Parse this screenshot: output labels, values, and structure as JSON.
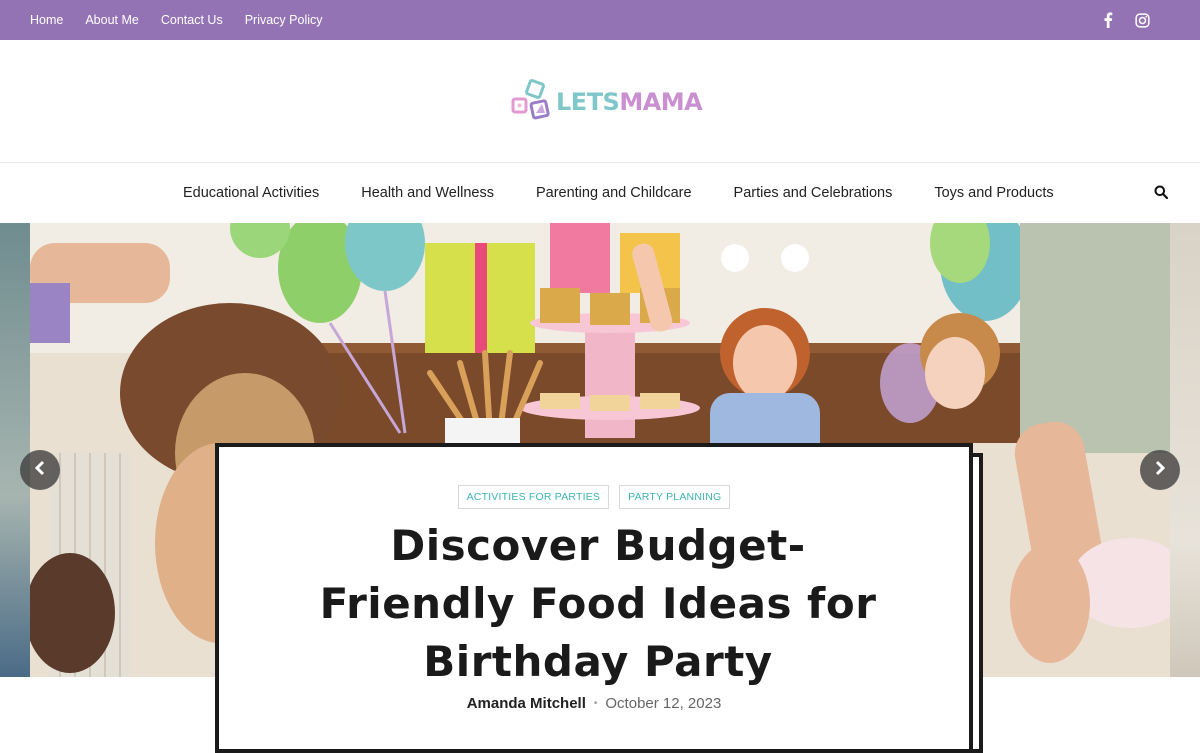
{
  "topbar": {
    "links": [
      "Home",
      "About Me",
      "Contact Us",
      "Privacy Policy"
    ],
    "social_icons": [
      "facebook-icon",
      "instagram-icon"
    ],
    "color": "#9473b5"
  },
  "logo": {
    "text_part1": "LETS",
    "text_part2": "MAMA",
    "colors": [
      "#7fc7c9",
      "#c98fd0"
    ]
  },
  "nav": {
    "items": [
      "Educational Activities",
      "Health and Wellness",
      "Parenting and Childcare",
      "Parties and Celebrations",
      "Toys and Products"
    ],
    "search_icon": "search-icon"
  },
  "hero": {
    "prev_icon": "chevron-left-icon",
    "next_icon": "chevron-right-icon"
  },
  "article": {
    "tags": [
      "Activities for Parties",
      "Party Planning"
    ],
    "title": "Discover Budget-Friendly Food Ideas for Birthday Party",
    "author": "Amanda Mitchell",
    "separator": "•",
    "date": "October 12, 2023",
    "tag_color": "#3fb3b3"
  }
}
